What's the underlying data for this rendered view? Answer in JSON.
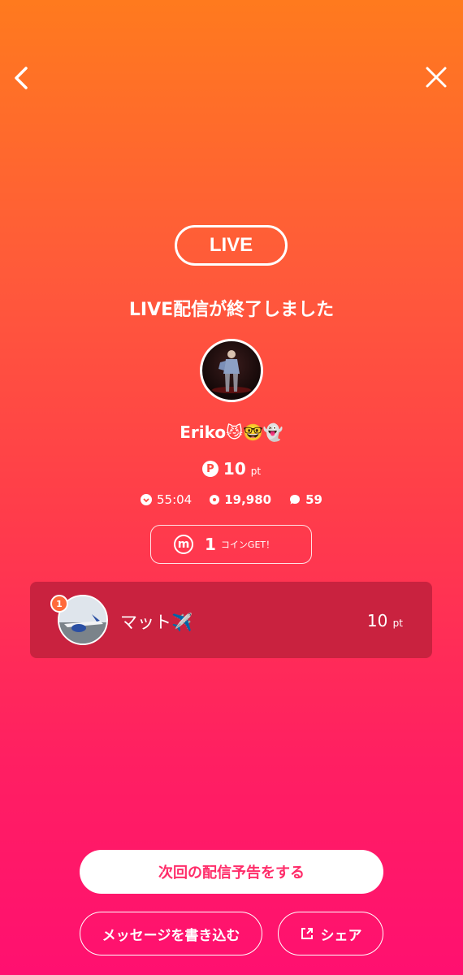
{
  "header": {
    "back_icon": "chevron-left-icon",
    "close_icon": "close-icon"
  },
  "live_badge": "LIVE",
  "ended_title": "LIVE配信が終了しました",
  "host": {
    "name": "Eriko😼🤓👻"
  },
  "points": {
    "value": "10",
    "unit": "pt",
    "icon_letter": "P"
  },
  "stats": {
    "duration": "55:04",
    "viewers": "19,980",
    "comments": "59"
  },
  "coin": {
    "icon_letter": "m",
    "count": "1",
    "label": "コインGET！"
  },
  "ranking": [
    {
      "rank": "1",
      "name": "マット✈️",
      "points": "10",
      "unit": "pt"
    }
  ],
  "buttons": {
    "schedule": "次回の配信予告をする",
    "message": "メッセージを書き込む",
    "share": "シェア"
  },
  "colors": {
    "gradient_top": "#ff7a1e",
    "gradient_bottom": "#ff1070",
    "card_bg": "#c9223f",
    "schedule_text": "#ff2d6a"
  }
}
